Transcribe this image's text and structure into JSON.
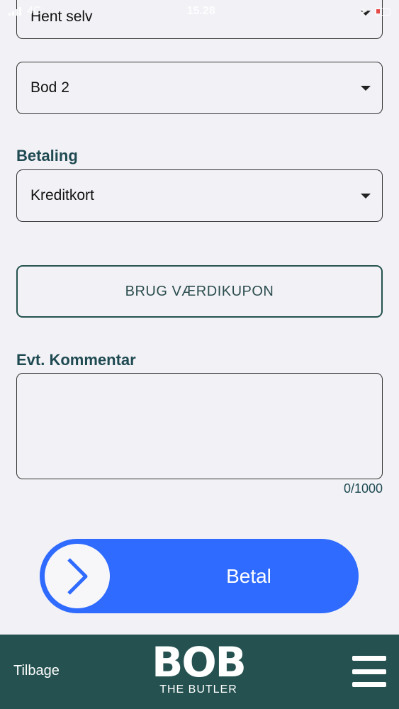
{
  "status_bar": {
    "network": "4G",
    "time": "15.28"
  },
  "form": {
    "delivery_value": "Hent selv",
    "stall_value": "Bod 2",
    "payment_label": "Betaling",
    "payment_value": "Kreditkort",
    "coupon_button": "BRUG VÆRDIKUPON",
    "comment_label": "Evt. Kommentar",
    "comment_value": "",
    "comment_counter": "0/1000"
  },
  "pay": {
    "label": "Betal",
    "accent_color": "#2f6bff"
  },
  "bottom_bar": {
    "back_label": "Tilbage",
    "logo_mark": "BOB",
    "logo_sub": "THE BUTLER",
    "background_color": "#255250"
  }
}
